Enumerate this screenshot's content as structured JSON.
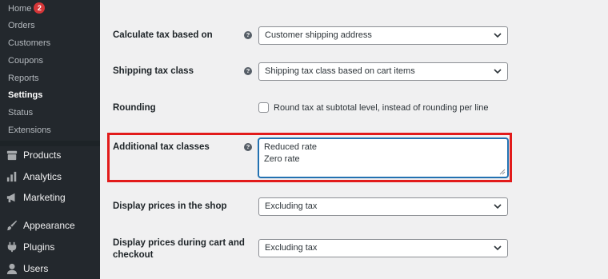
{
  "sidebar": {
    "submenu": [
      {
        "label": "Home",
        "badge": "2"
      },
      {
        "label": "Orders"
      },
      {
        "label": "Customers"
      },
      {
        "label": "Coupons"
      },
      {
        "label": "Reports"
      },
      {
        "label": "Settings",
        "current": true
      },
      {
        "label": "Status"
      },
      {
        "label": "Extensions"
      }
    ],
    "menu": [
      {
        "label": "Products",
        "icon": "archive-icon"
      },
      {
        "label": "Analytics",
        "icon": "bar-chart-icon"
      },
      {
        "label": "Marketing",
        "icon": "megaphone-icon"
      },
      {
        "label": "Appearance",
        "icon": "paintbrush-icon"
      },
      {
        "label": "Plugins",
        "icon": "plug-icon"
      },
      {
        "label": "Users",
        "icon": "user-icon"
      }
    ]
  },
  "settings": {
    "calc_tax": {
      "label": "Calculate tax based on",
      "value": "Customer shipping address"
    },
    "shipping_tax_class": {
      "label": "Shipping tax class",
      "value": "Shipping tax class based on cart items"
    },
    "rounding": {
      "label": "Rounding",
      "checkbox_label": "Round tax at subtotal level, instead of rounding per line",
      "checked": false
    },
    "additional_tax_classes": {
      "label": "Additional tax classes",
      "lines": [
        "Reduced rate",
        "Zero rate"
      ]
    },
    "display_shop": {
      "label": "Display prices in the shop",
      "value": "Excluding tax"
    },
    "display_cart": {
      "label_line1": "Display prices during cart and",
      "label_line2": "checkout",
      "value": "Excluding tax"
    }
  },
  "colors": {
    "sidebar_bg": "#23282d",
    "highlight_border": "#e21b1b",
    "badge": "#d63638",
    "focus_border": "#2271b1"
  },
  "help_icon_glyph": "?"
}
